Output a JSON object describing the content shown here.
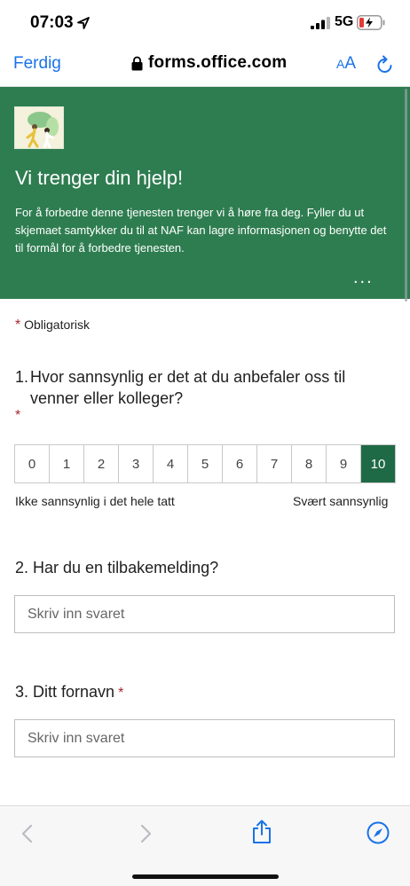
{
  "status": {
    "time": "07:03",
    "network": "5G"
  },
  "browser": {
    "done_label": "Ferdig",
    "url": "forms.office.com",
    "text_size_small": "A",
    "text_size_big": "A"
  },
  "banner": {
    "title": "Vi trenger din hjelp!",
    "description": "For å forbedre denne tjenesten trenger vi å høre fra deg. Fyller du ut skjemaet samtykker du til at NAF kan lagre informasjonen og benytte det til formål for å forbedre tjenesten.",
    "more": "...",
    "color": "#2e7d50"
  },
  "form": {
    "required_marker": "*",
    "required_label": "Obligatorisk",
    "q1": {
      "number": "1.",
      "text": "Hvor sannsynlig er det at du anbefaler oss til venner eller kolleger?",
      "scale": [
        "0",
        "1",
        "2",
        "3",
        "4",
        "5",
        "6",
        "7",
        "8",
        "9",
        "10"
      ],
      "selected": "10",
      "low_label": "Ikke sannsynlig i det hele tatt",
      "high_label": "Svært sannsynlig"
    },
    "q2": {
      "text": "2. Har du en tilbakemelding?",
      "placeholder": "Skriv inn svaret"
    },
    "q3": {
      "text": "3. Ditt fornavn",
      "placeholder": "Skriv inn svaret"
    }
  },
  "icons": {
    "location": "location-arrow-icon",
    "signal": "cellular-signal-icon",
    "battery": "battery-charging-icon",
    "lock": "lock-icon",
    "reload": "reload-icon",
    "back": "chevron-left-icon",
    "forward": "chevron-right-icon",
    "share": "share-icon",
    "compass": "compass-icon"
  },
  "colors": {
    "accent": "#1a73e8",
    "selected": "#1f6a46",
    "required": "#a4262c"
  }
}
